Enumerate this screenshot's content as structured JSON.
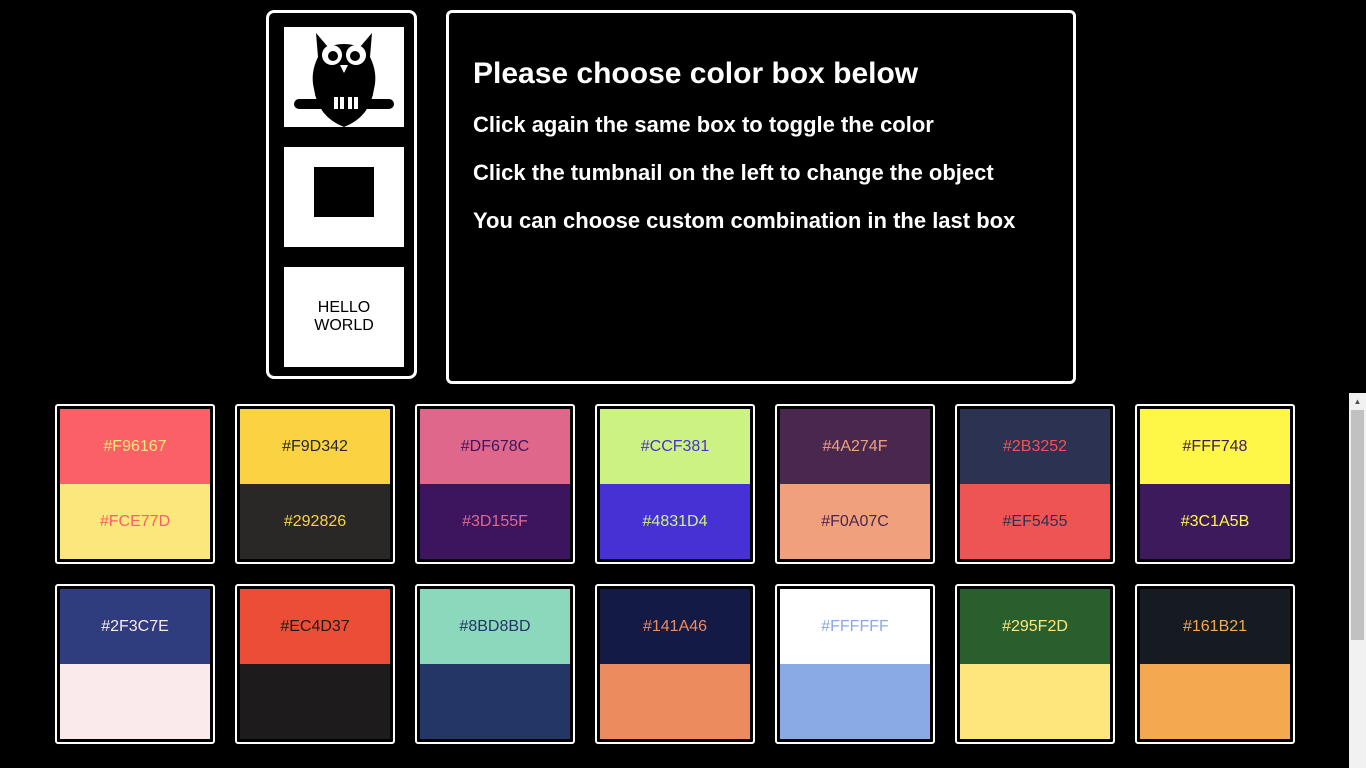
{
  "thumbnails": [
    {
      "name": "owl",
      "icon": "owl-icon"
    },
    {
      "name": "rectangle",
      "icon": "rectangle-icon"
    },
    {
      "name": "text",
      "text": "HELLO\nWORLD"
    }
  ],
  "info": {
    "title": "Please choose color box below",
    "lines": [
      "Click again the same box to toggle the color",
      "Click the tumbnail on the left to change the object",
      "You can choose custom combination in the last box"
    ]
  },
  "palettes": [
    {
      "top": {
        "bg": "#F96167",
        "label": "#F96167",
        "fg": "#FCE77D"
      },
      "bottom": {
        "bg": "#FCE77D",
        "label": "#FCE77D",
        "fg": "#F96167"
      }
    },
    {
      "top": {
        "bg": "#F9D342",
        "label": "#F9D342",
        "fg": "#292826"
      },
      "bottom": {
        "bg": "#292826",
        "label": "#292826",
        "fg": "#F9D342"
      }
    },
    {
      "top": {
        "bg": "#DF678C",
        "label": "#DF678C",
        "fg": "#3D155F"
      },
      "bottom": {
        "bg": "#3D155F",
        "label": "#3D155F",
        "fg": "#DF678C"
      }
    },
    {
      "top": {
        "bg": "#CCF381",
        "label": "#CCF381",
        "fg": "#4831D4"
      },
      "bottom": {
        "bg": "#4831D4",
        "label": "#4831D4",
        "fg": "#CCF381"
      }
    },
    {
      "top": {
        "bg": "#4A274F",
        "label": "#4A274F",
        "fg": "#F0A07C"
      },
      "bottom": {
        "bg": "#F0A07C",
        "label": "#F0A07C",
        "fg": "#4A274F"
      }
    },
    {
      "top": {
        "bg": "#2B3252",
        "label": "#2B3252",
        "fg": "#EF5455"
      },
      "bottom": {
        "bg": "#EF5455",
        "label": "#EF5455",
        "fg": "#2B3252"
      }
    },
    {
      "top": {
        "bg": "#FFF748",
        "label": "#FFF748",
        "fg": "#3C1A5B"
      },
      "bottom": {
        "bg": "#3C1A5B",
        "label": "#3C1A5B",
        "fg": "#FFF748"
      }
    },
    {
      "top": {
        "bg": "#2F3C7E",
        "label": "#2F3C7E",
        "fg": "#FBEAEB"
      },
      "bottom": {
        "bg": "#FBEAEB",
        "label": "",
        "fg": "#2F3C7E"
      }
    },
    {
      "top": {
        "bg": "#EC4D37",
        "label": "#EC4D37",
        "fg": "#1D1B1B"
      },
      "bottom": {
        "bg": "#1D1B1B",
        "label": "",
        "fg": "#EC4D37"
      }
    },
    {
      "top": {
        "bg": "#8BD8BD",
        "label": "#8BD8BD",
        "fg": "#243665"
      },
      "bottom": {
        "bg": "#243665",
        "label": "",
        "fg": "#8BD8BD"
      }
    },
    {
      "top": {
        "bg": "#141A46",
        "label": "#141A46",
        "fg": "#EC8B5E"
      },
      "bottom": {
        "bg": "#EC8B5E",
        "label": "",
        "fg": "#141A46"
      }
    },
    {
      "top": {
        "bg": "#FFFFFF",
        "label": "#FFFFFF",
        "fg": "#8AAAE5"
      },
      "bottom": {
        "bg": "#8AAAE5",
        "label": "",
        "fg": "#FFFFFF"
      }
    },
    {
      "top": {
        "bg": "#295F2D",
        "label": "#295F2D",
        "fg": "#FFE67C"
      },
      "bottom": {
        "bg": "#FFE67C",
        "label": "",
        "fg": "#295F2D"
      }
    },
    {
      "top": {
        "bg": "#161B21",
        "label": "#161B21",
        "fg": "#F4A950"
      },
      "bottom": {
        "bg": "#F4A950",
        "label": "",
        "fg": "#161B21"
      }
    }
  ]
}
